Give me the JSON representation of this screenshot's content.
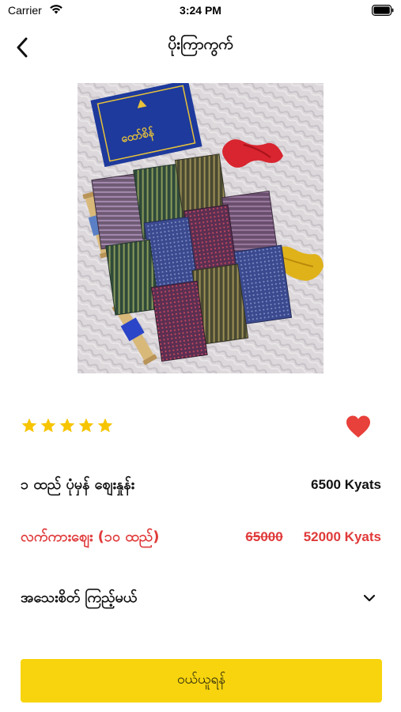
{
  "status_bar": {
    "carrier": "Carrier",
    "time": "3:24 PM"
  },
  "header": {
    "title": "ပိုးကြာကွက်"
  },
  "product": {
    "image_icon": "folded-silk-longyi-fabrics-photo",
    "image_box_text": "ထော်စိန်",
    "rating_stars": 5,
    "rating_color": "#f7c500",
    "favorite_color": "#e8403a",
    "unit_price_label": "၁ ထည် ပုံမှန် စျေးနှုန်း",
    "unit_price_value": "6500 Kyats",
    "wholesale_label": "လက်ကားစျေး (၁၀ ထည်)",
    "wholesale_old_price": "65000",
    "wholesale_price": "52000 Kyats",
    "sale_color": "#e03a3a",
    "details_label": "အသေးစိတ် ကြည့်မယ်"
  },
  "actions": {
    "buy_label": "ဝယ်ယူရန်",
    "buy_color": "#f7d40d"
  }
}
